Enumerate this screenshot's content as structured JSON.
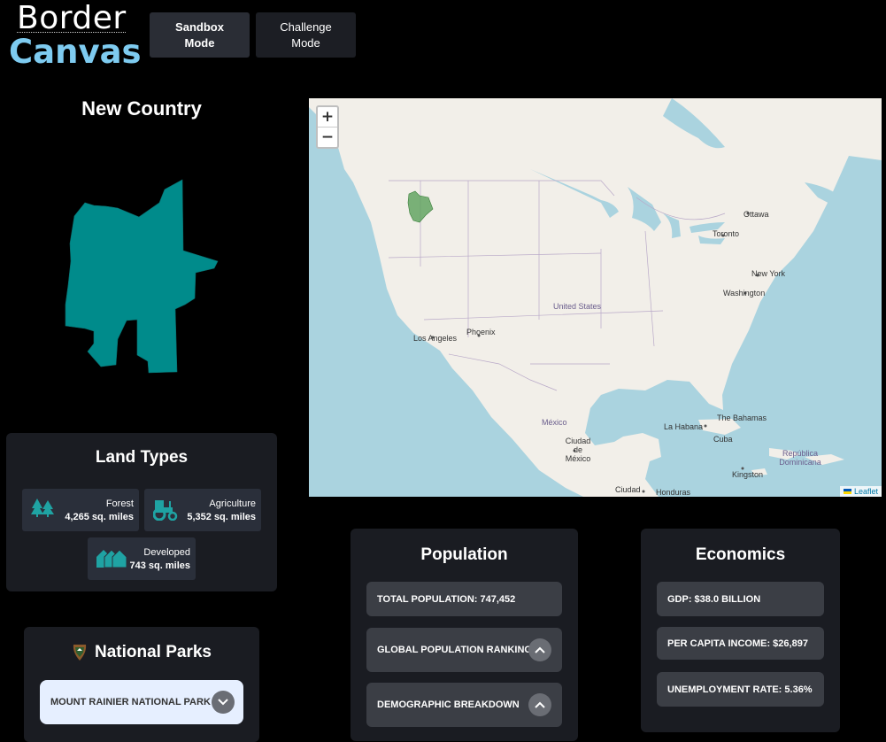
{
  "logo": {
    "line1": "Border",
    "line2": "Canvas"
  },
  "modes": [
    {
      "label": "Sandbox Mode"
    },
    {
      "label": "Challenge Mode"
    }
  ],
  "country": {
    "title": "New Country",
    "shape_color": "#008b8b"
  },
  "map": {
    "zoom_in": "+",
    "zoom_out": "−",
    "attribution": "Leaflet",
    "labels": {
      "ottawa": "Ottawa",
      "toronto": "Toronto",
      "new_york": "New York",
      "washington": "Washington",
      "united_states": "United States",
      "los_angeles": "Los Angeles",
      "phoenix": "Phoenix",
      "mexico": "México",
      "mexico_city": "Ciudad de México",
      "la_habana": "La Habana",
      "bahamas": "The Bahamas",
      "cuba": "Cuba",
      "kingston": "Kingston",
      "republica_dominicana": "República Dominicana",
      "ciudad": "Ciudad",
      "honduras": "Honduras"
    }
  },
  "land_types": {
    "title": "Land Types",
    "items": [
      {
        "name": "Forest",
        "value": "4,265 sq. miles",
        "icon": "forest-icon"
      },
      {
        "name": "Agriculture",
        "value": "5,352 sq. miles",
        "icon": "tractor-icon"
      },
      {
        "name": "Developed",
        "value": "743 sq. miles",
        "icon": "houses-icon"
      }
    ]
  },
  "national_parks": {
    "title": "National Parks",
    "icon": "nps-arrowhead-icon",
    "selected": "MOUNT RAINIER NATIONAL PARK"
  },
  "population": {
    "title": "Population",
    "total": "TOTAL POPULATION: 747,452",
    "ranking": "GLOBAL POPULATION RANKING",
    "demographic": "DEMOGRAPHIC BREAKDOWN"
  },
  "economics": {
    "title": "Economics",
    "gdp": "GDP: $38.0 BILLION",
    "income": "PER CAPITA INCOME: $26,897",
    "unemployment": "UNEMPLOYMENT RATE: 5.36%"
  }
}
